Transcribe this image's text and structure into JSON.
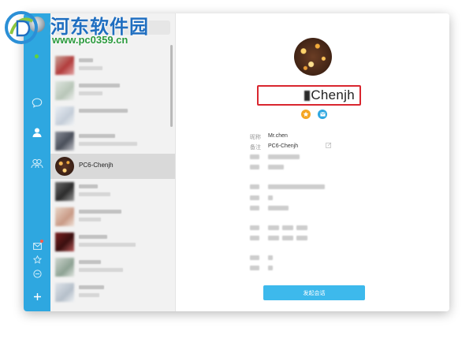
{
  "watermark": {
    "title": "河东软件园",
    "url": "www.pc0359.cn"
  },
  "rail": {
    "icons": [
      "chat-icon",
      "contacts-icon",
      "group-icon",
      "mail-icon",
      "star-icon",
      "minus-circle-icon",
      "plus-icon"
    ],
    "accent": "#2ea7e0"
  },
  "contacts": {
    "selected_name": "PC6-Chenjh"
  },
  "profile": {
    "display_name": "Chenjh",
    "nickname_label": "昵称",
    "nickname_value": "Mr.chen",
    "remark_label": "备注",
    "remark_value": "PC6-Chenjh",
    "action_button": "发起会话"
  },
  "colors": {
    "highlight_border": "#d9262f",
    "button": "#3db9ec",
    "star_badge": "#f5a623"
  }
}
